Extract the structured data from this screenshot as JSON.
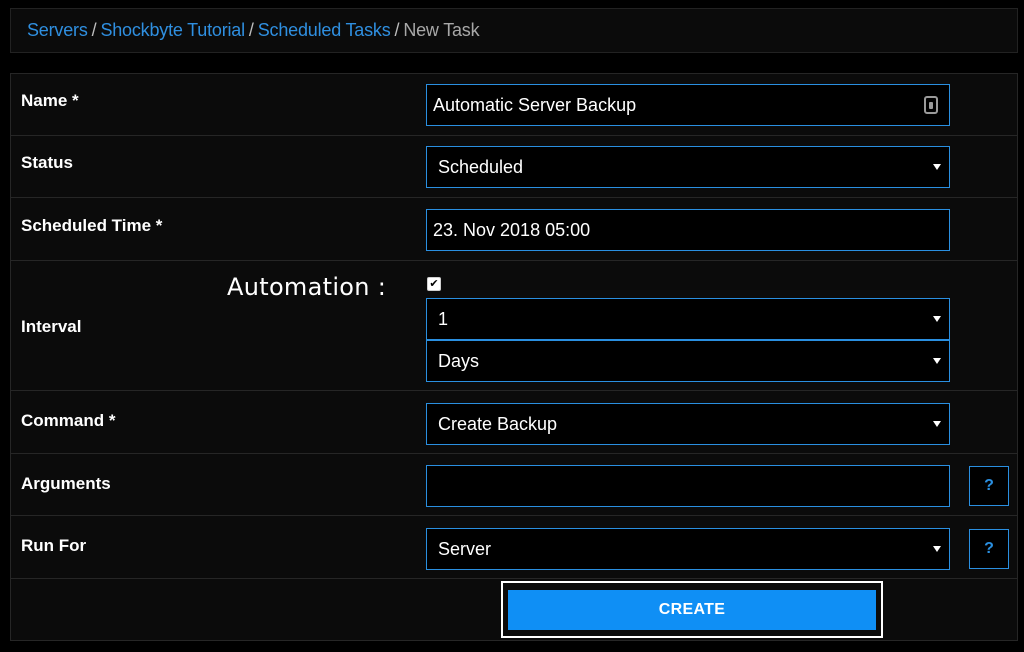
{
  "breadcrumb": {
    "items": [
      "Servers",
      "Shockbyte Tutorial",
      "Scheduled Tasks"
    ],
    "separator": "/",
    "current": "New Task"
  },
  "form": {
    "name": {
      "label": "Name *",
      "value": "Automatic Server Backup"
    },
    "status": {
      "label": "Status",
      "value": "Scheduled"
    },
    "scheduled_time": {
      "label": "Scheduled Time *",
      "value": "23. Nov 2018 05:00"
    },
    "interval": {
      "label": "Interval",
      "annotation": "Automation :",
      "checkbox_checked": true,
      "checkbox_mark": "✔",
      "amount": "1",
      "unit": "Days"
    },
    "command": {
      "label": "Command *",
      "value": "Create Backup"
    },
    "arguments": {
      "label": "Arguments",
      "value": "",
      "help": "?"
    },
    "run_for": {
      "label": "Run For",
      "value": "Server",
      "help": "?"
    },
    "submit_label": "CREATE"
  },
  "colors": {
    "background": "#000000",
    "panel": "#0b0b0b",
    "accent": "#2a8fe0",
    "button": "#0f8ff5"
  },
  "icons": {
    "dropdown": "caret-down-icon",
    "name_field_badge": "password-manager-icon",
    "help": "question-icon"
  }
}
